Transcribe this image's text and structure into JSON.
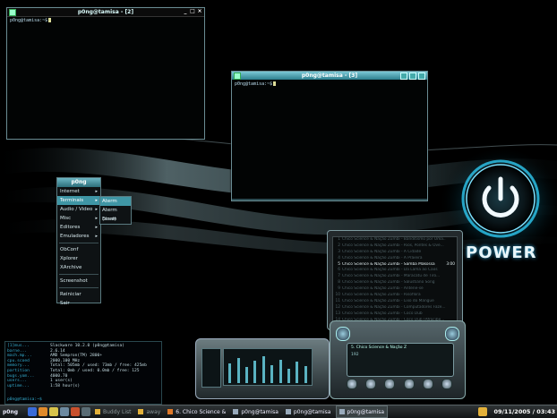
{
  "terminals": [
    {
      "title": "p0ng@tamisa - [2]",
      "prompt": "p0ng@tamisa:~$"
    },
    {
      "title": "p0ng@tamisa - [3]",
      "prompt": "p0ng@tamisa:~$"
    }
  ],
  "menu": {
    "title": "p0ng",
    "items": [
      {
        "label": "Internet",
        "submenu": true
      },
      {
        "label": "Terminais",
        "submenu": true
      },
      {
        "label": "Audio / Video",
        "submenu": true
      },
      {
        "label": "Misc",
        "submenu": true
      },
      {
        "label": "Editores",
        "submenu": true
      },
      {
        "label": "Emuladores",
        "submenu": true
      },
      {
        "label": "ObConf",
        "submenu": false
      },
      {
        "label": "Xplorer",
        "submenu": false
      },
      {
        "label": "XArchive",
        "submenu": false
      },
      {
        "label": "Screenshot",
        "submenu": false
      },
      {
        "label": "Reiniciar",
        "submenu": false
      },
      {
        "label": "Sair",
        "submenu": false
      }
    ],
    "arrow_glyph": "▸",
    "submenu_items": [
      "Aterm",
      "Aterm (ansi)",
      "Eterm"
    ]
  },
  "power_label": "POWER",
  "playlist": {
    "rows": [
      {
        "n": "1",
        "title": "Chico Science & Nação Zumbi - Banditismo por Uma...",
        "dur": ""
      },
      {
        "n": "2",
        "title": "Chico Science & Nação Zumbi - Rios, Pontes & Ove...",
        "dur": ""
      },
      {
        "n": "3",
        "title": "Chico Science & Nação Zumbi - A Cidade",
        "dur": ""
      },
      {
        "n": "4",
        "title": "Chico Science & Nação Zumbi - A Praieira",
        "dur": ""
      },
      {
        "n": "5",
        "title": "Chico Science & Nação Zumbi - Samba Makossa",
        "dur": "3:00"
      },
      {
        "n": "6",
        "title": "Chico Science & Nação Zumbi - Da Lama ao Caos",
        "dur": ""
      },
      {
        "n": "7",
        "title": "Chico Science & Nação Zumbi - Maracatu de Tiro...",
        "dur": ""
      },
      {
        "n": "8",
        "title": "Chico Science & Nação Zumbi - Salustiano Song",
        "dur": ""
      },
      {
        "n": "9",
        "title": "Chico Science & Nação Zumbi - Antene-se",
        "dur": ""
      },
      {
        "n": "10",
        "title": "Chico Science & Nação Zumbi - Risoflora",
        "dur": ""
      },
      {
        "n": "11",
        "title": "Chico Science & Nação Zumbi - Lixo do Mangue",
        "dur": ""
      },
      {
        "n": "12",
        "title": "Chico Science & Nação Zumbi - Computadores Faze...",
        "dur": ""
      },
      {
        "n": "13",
        "title": "Chico Science & Nação Zumbi - Coco Dub",
        "dur": ""
      },
      {
        "n": "14",
        "title": "Chico Science & Nação Zumbi - Côco Dub (Afrocibe...",
        "dur": ""
      }
    ],
    "current_index": 4
  },
  "player": {
    "now_playing": "5. Chico Science & Nação Z",
    "bitrate": "192"
  },
  "sysinfo": {
    "ls": [
      "[1]mus...",
      "barne...",
      "mach.mp...",
      "cpu.scoed",
      "memory...",
      "partition",
      "bugs.yom...",
      "users...",
      "uptime..."
    ],
    "info": [
      "Slackware 10.2.0 (p0ng@tamisa)",
      "2.6.14",
      "AMD Sempron(TM) 2800+",
      "2000.100 MHz",
      "Total: 505mb / used: 73mb / free: 425mb",
      "Total: 0mb / used: 0.0mb / free: 125",
      "4000.70",
      "1 user(s)",
      "1:58 hour(s)"
    ],
    "prompt": "p0ng@tamisa:~$"
  },
  "taskbar": {
    "start_label": "p0ng",
    "tasks": [
      {
        "label": "Buddy List",
        "state": "dim"
      },
      {
        "label": "away",
        "state": "dim"
      },
      {
        "label": "6. Chico Science &",
        "state": "normal"
      },
      {
        "label": "p0ng@tamisa",
        "state": "normal"
      },
      {
        "label": "p0ng@tamisa",
        "state": "normal"
      },
      {
        "label": "p0ng@tamisa",
        "state": "normal"
      }
    ],
    "clock": "09/11/2005 / 03:43"
  },
  "colors": {
    "accent": "#3f96a5",
    "power_glow": "#33c3e6"
  }
}
